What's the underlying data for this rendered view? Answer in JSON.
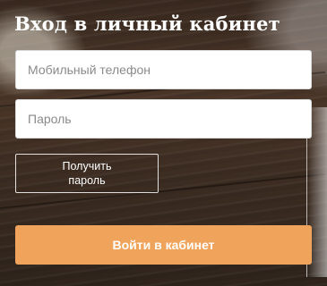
{
  "login": {
    "title": "Вход в личный кабинет",
    "phone_placeholder": "Мобильный телефон",
    "phone_value": "",
    "password_placeholder": "Пароль",
    "password_value": "",
    "get_password_label": "Получить пароль",
    "submit_label": "Войти в кабинет"
  },
  "colors": {
    "accent": "#f0a35a",
    "title_text": "#ffffff",
    "field_background": "#ffffff"
  }
}
